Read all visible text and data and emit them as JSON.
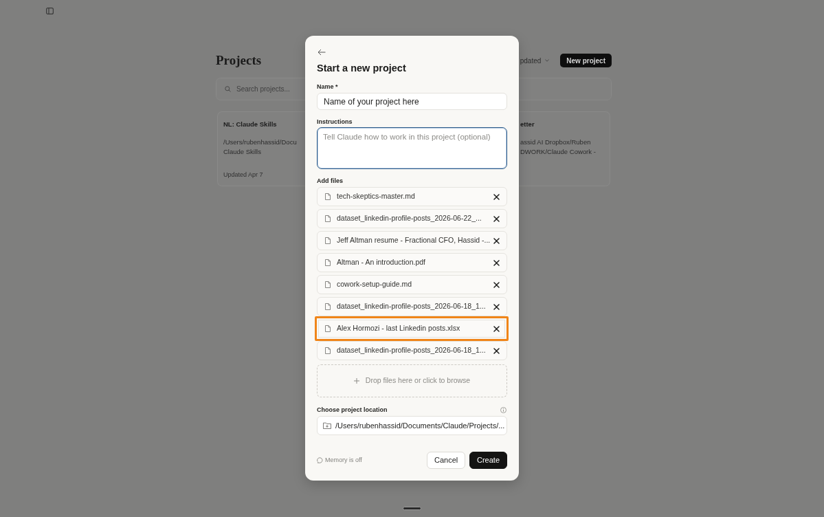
{
  "projects_page": {
    "title": "Projects",
    "sort_menu": {
      "label": "pdated"
    },
    "new_project_button": "New project",
    "search": {
      "placeholder": "Search projects..."
    },
    "cards": [
      {
        "title": "NL: Claude Skills",
        "path_lines": [
          "/Users/rubenhassid/Docu",
          "Claude Skills"
        ],
        "updated": "Updated Apr 7"
      },
      {
        "title": "etter",
        "path_lines": [
          "assid AI Dropbox/Ruben",
          "DWORK/Claude Cowork -"
        ]
      }
    ]
  },
  "dialog": {
    "title": "Start a new project",
    "name_field": {
      "label": "Name",
      "required_mark": "*",
      "value": "Name of your project here"
    },
    "instructions_field": {
      "label": "Instructions",
      "placeholder": "Tell Claude how to work in this project (optional)",
      "focused": true
    },
    "files_label": "Add files",
    "files": [
      {
        "name": "tech-skeptics-master.md",
        "highlighted": false
      },
      {
        "name": "dataset_linkedin-profile-posts_2026-06-22_...",
        "highlighted": false
      },
      {
        "name": "Jeff Altman resume - Fractional CFO, Hassid -...",
        "highlighted": false
      },
      {
        "name": "Altman - An introduction.pdf",
        "highlighted": false
      },
      {
        "name": "cowork-setup-guide.md",
        "highlighted": false
      },
      {
        "name": "dataset_linkedin-profile-posts_2026-06-18_1...",
        "highlighted": false
      },
      {
        "name": "Alex Hormozi - last Linkedin posts.xlsx",
        "highlighted": true
      },
      {
        "name": "dataset_linkedin-profile-posts_2026-06-18_1...",
        "highlighted": false
      }
    ],
    "drop_zone": "Drop files here or click to browse",
    "location": {
      "label": "Choose project location",
      "value": "/Users/rubenhassid/Documents/Claude/Projects/..."
    },
    "memory_status": "Memory is off",
    "buttons": [
      {
        "label": "Cancel",
        "kind": "secondary"
      },
      {
        "label": "Create",
        "kind": "primary"
      }
    ]
  }
}
